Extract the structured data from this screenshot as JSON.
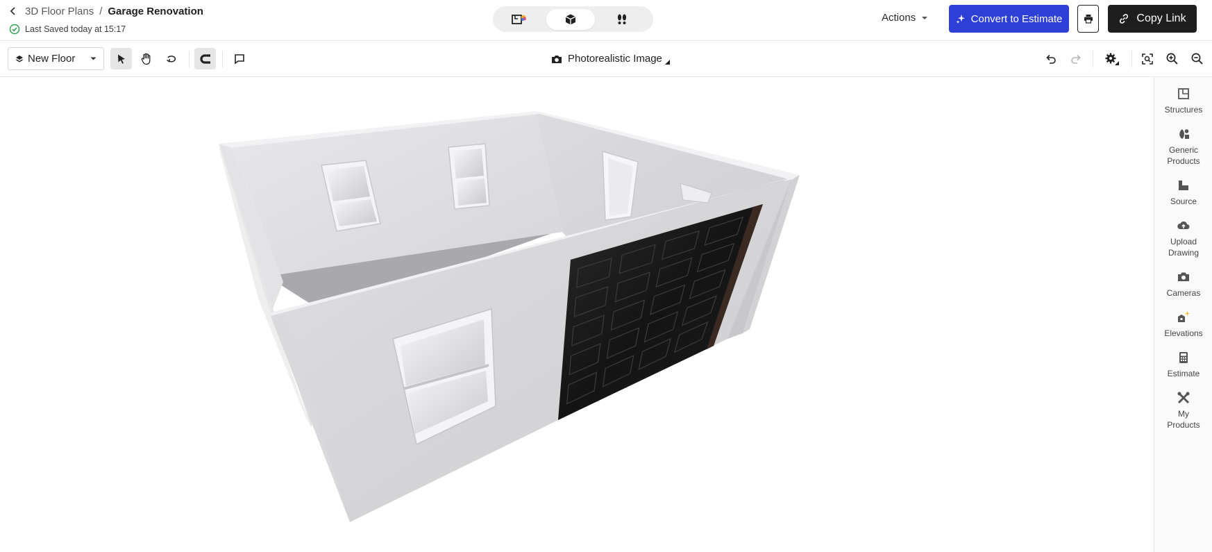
{
  "header": {
    "breadcrumb_parent": "3D Floor Plans",
    "breadcrumb_separator": "/",
    "project_title": "Garage Renovation",
    "saved_status": "Last Saved today at 15:17",
    "view_modes": [
      "2d-floorplan-icon",
      "3d-box-icon",
      "walkthrough-icon"
    ],
    "active_view": "3d-box-icon",
    "actions_label": "Actions",
    "convert_label": "Convert to Estimate",
    "copy_link_label": "Copy Link"
  },
  "toolbar": {
    "floor_label": "New Floor",
    "render_label": "Photorealistic Image"
  },
  "right_panel": {
    "items": [
      {
        "label": "Structures",
        "icon": "structures-icon"
      },
      {
        "label": "Generic\nProducts",
        "icon": "generic-products-icon"
      },
      {
        "label": "Source",
        "icon": "source-icon"
      },
      {
        "label": "Upload\nDrawing",
        "icon": "upload-cloud-icon"
      },
      {
        "label": "Cameras",
        "icon": "camera-icon"
      },
      {
        "label": "Elevations",
        "icon": "elevations-icon"
      },
      {
        "label": "Estimate",
        "icon": "calculator-icon"
      },
      {
        "label": "My\nProducts",
        "icon": "my-products-icon"
      }
    ]
  },
  "colors": {
    "primary": "#2e3fd6",
    "dark_button": "#1e1e1e",
    "saved_check": "#2e9e4f",
    "garage_door": "#161616"
  }
}
